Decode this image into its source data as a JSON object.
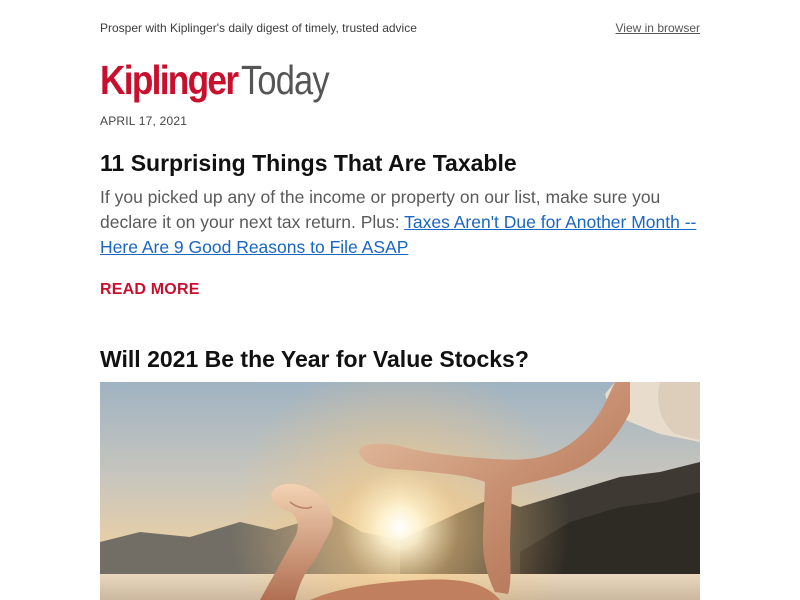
{
  "header": {
    "tagline": "Prosper with Kiplinger's daily digest of timely, trusted advice",
    "view_in_browser": "View in browser"
  },
  "logo": {
    "brand": "Kiplinger",
    "product": "Today"
  },
  "date": "APRIL 17, 2021",
  "article1": {
    "title": "11 Surprising Things That Are Taxable",
    "summary_text": "If you picked up any of the income or property on our list, make sure you declare it on your next tax return. Plus: ",
    "summary_link": "Taxes Aren't Due for Another Month -- Here Are 9 Good Reasons to File ASAP",
    "read_more": "READ MORE"
  },
  "article2": {
    "title": "Will 2021 Be the Year for Value Stocks?",
    "image_icon": "hands-framing-sunset-photo"
  },
  "colors": {
    "brand_red": "#c8102e",
    "link_blue": "#1a66c1",
    "body_gray": "#5a5a5a"
  }
}
